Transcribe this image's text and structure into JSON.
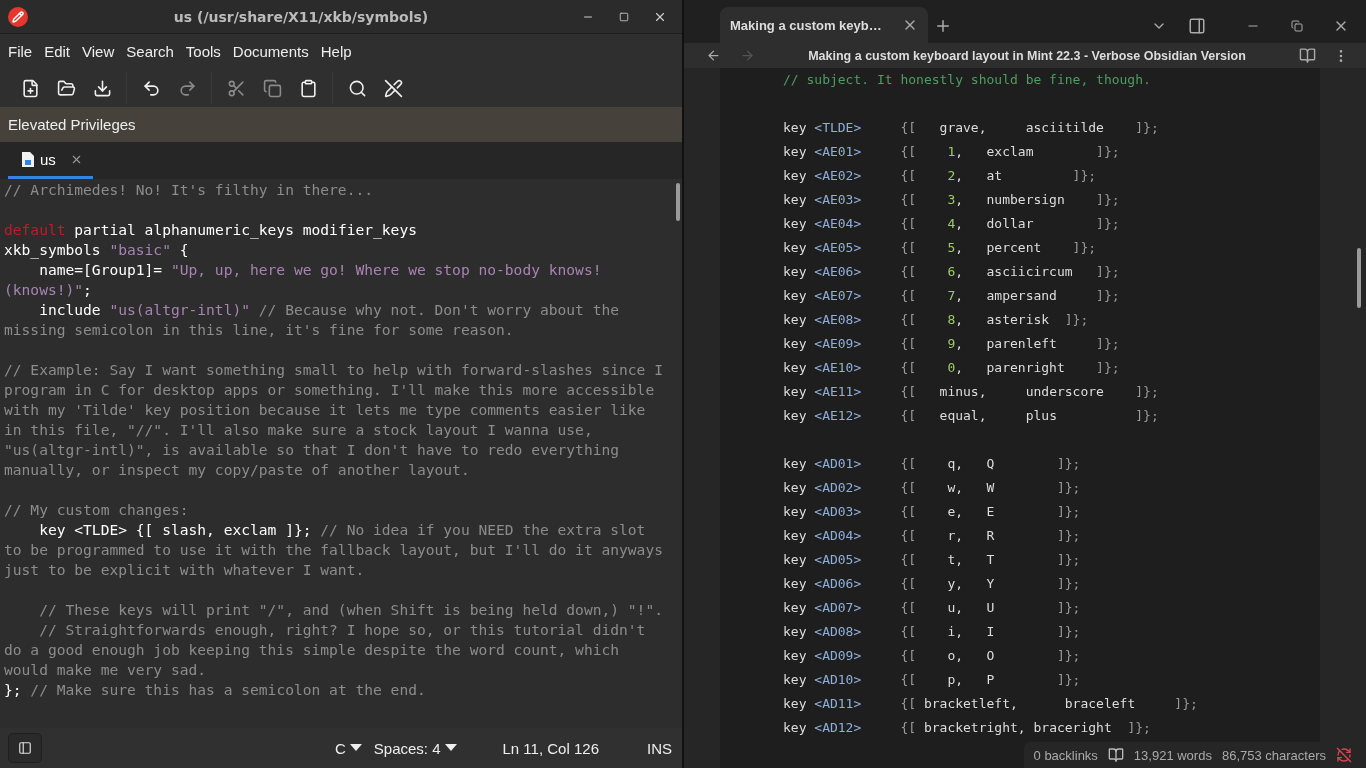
{
  "editor_window": {
    "title": "us (/usr/share/X11/xkb/symbols)",
    "menu": [
      "File",
      "Edit",
      "View",
      "Search",
      "Tools",
      "Documents",
      "Help"
    ],
    "toolbar": [
      [
        {
          "kind": "new",
          "disabled": false
        },
        {
          "kind": "open",
          "disabled": false
        },
        {
          "kind": "save",
          "disabled": false
        }
      ],
      [
        {
          "kind": "undo",
          "disabled": false
        },
        {
          "kind": "redo",
          "disabled": true
        }
      ],
      [
        {
          "kind": "cut",
          "disabled": true
        },
        {
          "kind": "copy",
          "disabled": true
        },
        {
          "kind": "paste",
          "disabled": false
        }
      ],
      [
        {
          "kind": "search",
          "disabled": false
        },
        {
          "kind": "spellcheck",
          "disabled": false
        }
      ]
    ],
    "banner": "Elevated Privileges",
    "tabs": [
      {
        "label": "us",
        "selected": true
      }
    ],
    "lines": [
      {
        "kind": "code",
        "segments": [
          {
            "kind": "comment",
            "text": "// Archimedes! No! It's filthy in there..."
          }
        ]
      },
      {
        "kind": "blank"
      },
      {
        "kind": "code",
        "segments": [
          {
            "kind": "keyword",
            "text": "default"
          },
          {
            "kind": "plain",
            "text": " partial alphanumeric_keys modifier_keys"
          }
        ]
      },
      {
        "kind": "code",
        "segments": [
          {
            "kind": "plain",
            "text": "xkb_symbols "
          },
          {
            "kind": "string",
            "text": "\"basic\""
          },
          {
            "kind": "plain",
            "text": " {"
          }
        ]
      },
      {
        "kind": "code",
        "segments": [
          {
            "kind": "plain",
            "text": "    name=[Group1]= "
          },
          {
            "kind": "string",
            "text": "\"Up, up, here we go! Where we stop no-body knows!"
          }
        ]
      },
      {
        "kind": "code",
        "segments": [
          {
            "kind": "string",
            "text": "(knows!)\""
          },
          {
            "kind": "plain",
            "text": ";"
          }
        ]
      },
      {
        "kind": "code",
        "segments": [
          {
            "kind": "plain",
            "text": "    include "
          },
          {
            "kind": "string",
            "text": "\"us(altgr-intl)\""
          },
          {
            "kind": "comment",
            "text": " // Because why not. Don't worry about the"
          }
        ]
      },
      {
        "kind": "code",
        "segments": [
          {
            "kind": "comment",
            "text": "missing semicolon in this line, it's fine for some reason."
          }
        ]
      },
      {
        "kind": "blank"
      },
      {
        "kind": "code",
        "segments": [
          {
            "kind": "comment",
            "text": "// Example: Say I want something small to help with forward-slashes since I"
          }
        ]
      },
      {
        "kind": "code",
        "segments": [
          {
            "kind": "comment",
            "text": "program in C for desktop apps or something. I'll make this more accessible"
          }
        ]
      },
      {
        "kind": "code",
        "segments": [
          {
            "kind": "comment",
            "text": "with my 'Tilde' key position because it lets me type comments easier like"
          }
        ]
      },
      {
        "kind": "code",
        "segments": [
          {
            "kind": "comment",
            "text": "in this file, \"//\". I'll also make sure a stock layout I wanna use,"
          }
        ]
      },
      {
        "kind": "code",
        "segments": [
          {
            "kind": "comment",
            "text": "\"us(altgr-intl)\", is available so that I don't have to redo everything"
          }
        ]
      },
      {
        "kind": "code",
        "segments": [
          {
            "kind": "comment",
            "text": "manually, or inspect my copy/paste of another layout."
          }
        ]
      },
      {
        "kind": "blank"
      },
      {
        "kind": "code",
        "segments": [
          {
            "kind": "comment",
            "text": "// My custom changes:"
          }
        ]
      },
      {
        "kind": "code",
        "segments": [
          {
            "kind": "plain",
            "text": "    key <TLDE> {[ slash, exclam ]};"
          },
          {
            "kind": "comment",
            "text": " // No idea if you NEED the extra slot"
          }
        ]
      },
      {
        "kind": "code",
        "segments": [
          {
            "kind": "comment",
            "text": "to be programmed to use it with the fallback layout, but I'll do it anyways"
          }
        ]
      },
      {
        "kind": "code",
        "segments": [
          {
            "kind": "comment",
            "text": "just to be explicit with whatever I want."
          }
        ]
      },
      {
        "kind": "blank"
      },
      {
        "kind": "code",
        "segments": [
          {
            "kind": "comment",
            "text": "    // These keys will print \"/\", and (when Shift is being held down,) \"!\"."
          }
        ]
      },
      {
        "kind": "code",
        "segments": [
          {
            "kind": "comment",
            "text": "    // Straightforwards enough, right? I hope so, or this tutorial didn't"
          }
        ]
      },
      {
        "kind": "code",
        "segments": [
          {
            "kind": "comment",
            "text": "do a good enough job keeping this simple despite the word count, which"
          }
        ]
      },
      {
        "kind": "code",
        "segments": [
          {
            "kind": "comment",
            "text": "would make me very sad."
          }
        ]
      },
      {
        "kind": "code",
        "segments": [
          {
            "kind": "plain",
            "text": "};"
          },
          {
            "kind": "comment",
            "text": " // Make sure this has a semicolon at the end."
          }
        ]
      }
    ],
    "status": {
      "language": "C",
      "indent": "Spaces: 4",
      "position": "Ln 11, Col 126",
      "mode": "INS"
    }
  },
  "notes_window": {
    "tabs": [
      {
        "label": "Making a custom keyb…",
        "selected": true
      }
    ],
    "title": "Making a custom keyboard layout in Mint 22.3 - Verbose Obsidian Version",
    "lines": [
      {
        "kind": "code",
        "segments": [
          {
            "kind": "comment",
            "text": "// subject. It honestly should be fine, though."
          }
        ]
      },
      {
        "kind": "blank"
      },
      {
        "kind": "code",
        "segments": [
          {
            "kind": "plain",
            "text": "key "
          },
          {
            "kind": "tag",
            "text": "<TLDE>"
          },
          {
            "kind": "punct",
            "text": "     {[   "
          },
          {
            "kind": "plain",
            "text": "grave,     asciitilde    "
          },
          {
            "kind": "punct",
            "text": "]};"
          }
        ]
      },
      {
        "kind": "code",
        "segments": [
          {
            "kind": "plain",
            "text": "key "
          },
          {
            "kind": "tag",
            "text": "<AE01>"
          },
          {
            "kind": "punct",
            "text": "     {[    "
          },
          {
            "kind": "number",
            "text": "1"
          },
          {
            "kind": "plain",
            "text": ",   exclam        "
          },
          {
            "kind": "punct",
            "text": "]};"
          }
        ]
      },
      {
        "kind": "code",
        "segments": [
          {
            "kind": "plain",
            "text": "key "
          },
          {
            "kind": "tag",
            "text": "<AE02>"
          },
          {
            "kind": "punct",
            "text": "     {[    "
          },
          {
            "kind": "number",
            "text": "2"
          },
          {
            "kind": "plain",
            "text": ",   at         "
          },
          {
            "kind": "punct",
            "text": "]};"
          }
        ]
      },
      {
        "kind": "code",
        "segments": [
          {
            "kind": "plain",
            "text": "key "
          },
          {
            "kind": "tag",
            "text": "<AE03>"
          },
          {
            "kind": "punct",
            "text": "     {[    "
          },
          {
            "kind": "number",
            "text": "3"
          },
          {
            "kind": "plain",
            "text": ",   numbersign    "
          },
          {
            "kind": "punct",
            "text": "]};"
          }
        ]
      },
      {
        "kind": "code",
        "segments": [
          {
            "kind": "plain",
            "text": "key "
          },
          {
            "kind": "tag",
            "text": "<AE04>"
          },
          {
            "kind": "punct",
            "text": "     {[    "
          },
          {
            "kind": "number",
            "text": "4"
          },
          {
            "kind": "plain",
            "text": ",   dollar        "
          },
          {
            "kind": "punct",
            "text": "]};"
          }
        ]
      },
      {
        "kind": "code",
        "segments": [
          {
            "kind": "plain",
            "text": "key "
          },
          {
            "kind": "tag",
            "text": "<AE05>"
          },
          {
            "kind": "punct",
            "text": "     {[    "
          },
          {
            "kind": "number",
            "text": "5"
          },
          {
            "kind": "plain",
            "text": ",   percent    "
          },
          {
            "kind": "punct",
            "text": "]};"
          }
        ]
      },
      {
        "kind": "code",
        "segments": [
          {
            "kind": "plain",
            "text": "key "
          },
          {
            "kind": "tag",
            "text": "<AE06>"
          },
          {
            "kind": "punct",
            "text": "     {[    "
          },
          {
            "kind": "number",
            "text": "6"
          },
          {
            "kind": "plain",
            "text": ",   asciicircum   "
          },
          {
            "kind": "punct",
            "text": "]};"
          }
        ]
      },
      {
        "kind": "code",
        "segments": [
          {
            "kind": "plain",
            "text": "key "
          },
          {
            "kind": "tag",
            "text": "<AE07>"
          },
          {
            "kind": "punct",
            "text": "     {[    "
          },
          {
            "kind": "number",
            "text": "7"
          },
          {
            "kind": "plain",
            "text": ",   ampersand     "
          },
          {
            "kind": "punct",
            "text": "]};"
          }
        ]
      },
      {
        "kind": "code",
        "segments": [
          {
            "kind": "plain",
            "text": "key "
          },
          {
            "kind": "tag",
            "text": "<AE08>"
          },
          {
            "kind": "punct",
            "text": "     {[    "
          },
          {
            "kind": "number",
            "text": "8"
          },
          {
            "kind": "plain",
            "text": ",   asterisk  "
          },
          {
            "kind": "punct",
            "text": "]};"
          }
        ]
      },
      {
        "kind": "code",
        "segments": [
          {
            "kind": "plain",
            "text": "key "
          },
          {
            "kind": "tag",
            "text": "<AE09>"
          },
          {
            "kind": "punct",
            "text": "     {[    "
          },
          {
            "kind": "number",
            "text": "9"
          },
          {
            "kind": "plain",
            "text": ",   parenleft     "
          },
          {
            "kind": "punct",
            "text": "]};"
          }
        ]
      },
      {
        "kind": "code",
        "segments": [
          {
            "kind": "plain",
            "text": "key "
          },
          {
            "kind": "tag",
            "text": "<AE10>"
          },
          {
            "kind": "punct",
            "text": "     {[    "
          },
          {
            "kind": "number",
            "text": "0"
          },
          {
            "kind": "plain",
            "text": ",   parenright    "
          },
          {
            "kind": "punct",
            "text": "]};"
          }
        ]
      },
      {
        "kind": "code",
        "segments": [
          {
            "kind": "plain",
            "text": "key "
          },
          {
            "kind": "tag",
            "text": "<AE11>"
          },
          {
            "kind": "punct",
            "text": "     {[   "
          },
          {
            "kind": "plain",
            "text": "minus,     underscore    "
          },
          {
            "kind": "punct",
            "text": "]};"
          }
        ]
      },
      {
        "kind": "code",
        "segments": [
          {
            "kind": "plain",
            "text": "key "
          },
          {
            "kind": "tag",
            "text": "<AE12>"
          },
          {
            "kind": "punct",
            "text": "     {[   "
          },
          {
            "kind": "plain",
            "text": "equal,     plus          "
          },
          {
            "kind": "punct",
            "text": "]};"
          }
        ]
      },
      {
        "kind": "blank"
      },
      {
        "kind": "code",
        "segments": [
          {
            "kind": "plain",
            "text": "key "
          },
          {
            "kind": "tag",
            "text": "<AD01>"
          },
          {
            "kind": "punct",
            "text": "     {[    "
          },
          {
            "kind": "plain",
            "text": "q,   Q        "
          },
          {
            "kind": "punct",
            "text": "]};"
          }
        ]
      },
      {
        "kind": "code",
        "segments": [
          {
            "kind": "plain",
            "text": "key "
          },
          {
            "kind": "tag",
            "text": "<AD02>"
          },
          {
            "kind": "punct",
            "text": "     {[    "
          },
          {
            "kind": "plain",
            "text": "w,   W        "
          },
          {
            "kind": "punct",
            "text": "]};"
          }
        ]
      },
      {
        "kind": "code",
        "segments": [
          {
            "kind": "plain",
            "text": "key "
          },
          {
            "kind": "tag",
            "text": "<AD03>"
          },
          {
            "kind": "punct",
            "text": "     {[    "
          },
          {
            "kind": "plain",
            "text": "e,   E        "
          },
          {
            "kind": "punct",
            "text": "]};"
          }
        ]
      },
      {
        "kind": "code",
        "segments": [
          {
            "kind": "plain",
            "text": "key "
          },
          {
            "kind": "tag",
            "text": "<AD04>"
          },
          {
            "kind": "punct",
            "text": "     {[    "
          },
          {
            "kind": "plain",
            "text": "r,   R        "
          },
          {
            "kind": "punct",
            "text": "]};"
          }
        ]
      },
      {
        "kind": "code",
        "segments": [
          {
            "kind": "plain",
            "text": "key "
          },
          {
            "kind": "tag",
            "text": "<AD05>"
          },
          {
            "kind": "punct",
            "text": "     {[    "
          },
          {
            "kind": "plain",
            "text": "t,   T        "
          },
          {
            "kind": "punct",
            "text": "]};"
          }
        ]
      },
      {
        "kind": "code",
        "segments": [
          {
            "kind": "plain",
            "text": "key "
          },
          {
            "kind": "tag",
            "text": "<AD06>"
          },
          {
            "kind": "punct",
            "text": "     {[    "
          },
          {
            "kind": "plain",
            "text": "y,   Y        "
          },
          {
            "kind": "punct",
            "text": "]};"
          }
        ]
      },
      {
        "kind": "code",
        "segments": [
          {
            "kind": "plain",
            "text": "key "
          },
          {
            "kind": "tag",
            "text": "<AD07>"
          },
          {
            "kind": "punct",
            "text": "     {[    "
          },
          {
            "kind": "plain",
            "text": "u,   U        "
          },
          {
            "kind": "punct",
            "text": "]};"
          }
        ]
      },
      {
        "kind": "code",
        "segments": [
          {
            "kind": "plain",
            "text": "key "
          },
          {
            "kind": "tag",
            "text": "<AD08>"
          },
          {
            "kind": "punct",
            "text": "     {[    "
          },
          {
            "kind": "plain",
            "text": "i,   I        "
          },
          {
            "kind": "punct",
            "text": "]};"
          }
        ]
      },
      {
        "kind": "code",
        "segments": [
          {
            "kind": "plain",
            "text": "key "
          },
          {
            "kind": "tag",
            "text": "<AD09>"
          },
          {
            "kind": "punct",
            "text": "     {[    "
          },
          {
            "kind": "plain",
            "text": "o,   O        "
          },
          {
            "kind": "punct",
            "text": "]};"
          }
        ]
      },
      {
        "kind": "code",
        "segments": [
          {
            "kind": "plain",
            "text": "key "
          },
          {
            "kind": "tag",
            "text": "<AD10>"
          },
          {
            "kind": "punct",
            "text": "     {[    "
          },
          {
            "kind": "plain",
            "text": "p,   P        "
          },
          {
            "kind": "punct",
            "text": "]};"
          }
        ]
      },
      {
        "kind": "code",
        "segments": [
          {
            "kind": "plain",
            "text": "key "
          },
          {
            "kind": "tag",
            "text": "<AD11>"
          },
          {
            "kind": "punct",
            "text": "     {[ "
          },
          {
            "kind": "plain",
            "text": "bracketleft,      braceleft     "
          },
          {
            "kind": "punct",
            "text": "]};"
          }
        ]
      },
      {
        "kind": "code",
        "segments": [
          {
            "kind": "plain",
            "text": "key "
          },
          {
            "kind": "tag",
            "text": "<AD12>"
          },
          {
            "kind": "punct",
            "text": "     {[ "
          },
          {
            "kind": "plain",
            "text": "bracketright, braceright  "
          },
          {
            "kind": "punct",
            "text": "]};"
          }
        ]
      }
    ],
    "status": {
      "backlinks": "0 backlinks",
      "words": "13,921 words",
      "characters": "86,753 characters"
    }
  }
}
